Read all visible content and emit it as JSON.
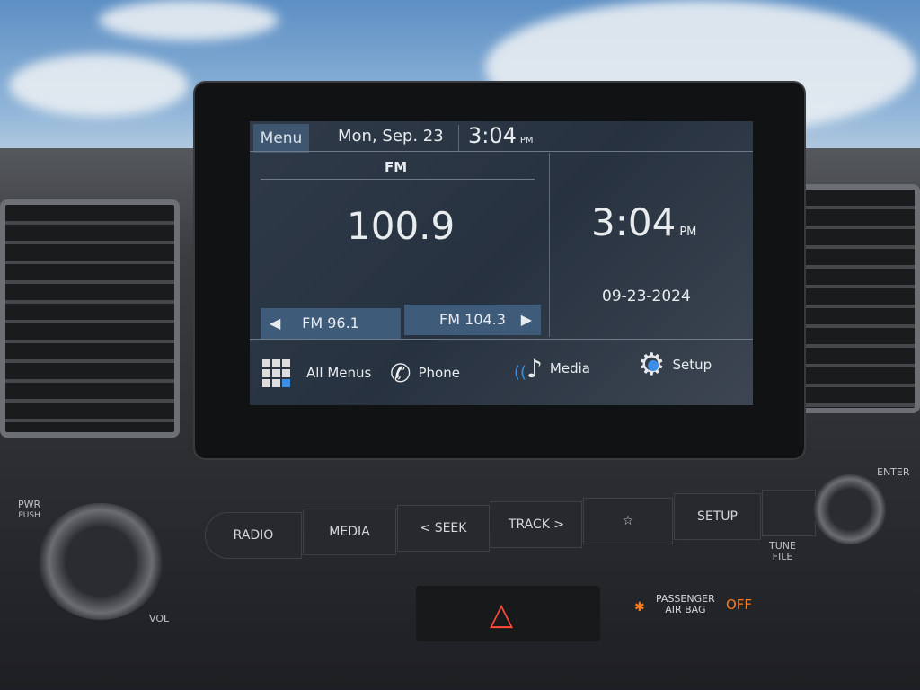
{
  "header": {
    "menu_label": "Menu",
    "date": "Mon, Sep. 23",
    "time": "3:04",
    "ampm": "PM"
  },
  "radio": {
    "band": "FM",
    "frequency": "100.9",
    "prev_preset": "FM 96.1",
    "next_preset": "FM 104.3"
  },
  "clock": {
    "time": "3:04",
    "ampm": "PM",
    "date": "09-23-2024"
  },
  "bottom_menu": [
    {
      "label": "All Menus",
      "icon": "grid-icon"
    },
    {
      "label": "Phone",
      "icon": "phone-icon"
    },
    {
      "label": "Media",
      "icon": "music-note-icon"
    },
    {
      "label": "Setup",
      "icon": "gear-icon"
    }
  ],
  "hardware": {
    "buttons": [
      "RADIO",
      "MEDIA",
      "< SEEK",
      "TRACK >",
      "☆",
      "SETUP"
    ],
    "pwr": "PWR",
    "push": "PUSH",
    "vol": "VOL",
    "enter": "ENTER",
    "tune": "TUNE",
    "file": "FILE",
    "airbag_line1": "PASSENGER",
    "airbag_line2": "AIR BAG",
    "airbag_status": "OFF"
  },
  "colors": {
    "accent": "#3a8ee6",
    "preset_bg": "#3f5b7a",
    "airbag_orange": "#ff7a1a",
    "hazard_red": "#ff4a3a"
  }
}
